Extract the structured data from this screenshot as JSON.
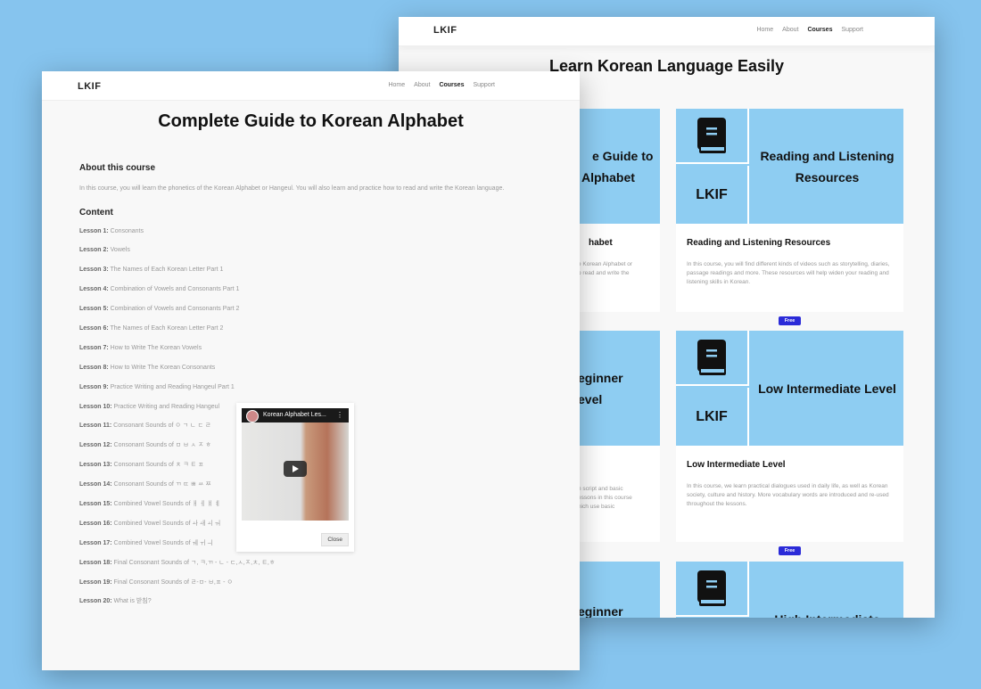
{
  "back_window": {
    "logo": "LKIF",
    "nav": [
      "Home",
      "About",
      "Courses",
      "Support"
    ],
    "title": "Learn Korean Language Easily",
    "left_cards": [
      {
        "tile_lines": [
          "e Guide to",
          "Alphabet"
        ],
        "title": "habet",
        "desc": [
          "e Korean Alphabet or",
          "o read and write the"
        ]
      },
      {
        "tile_lines": [
          "eginner",
          "evel"
        ],
        "title": "",
        "desc": [
          "n script and basic",
          "essons in this course",
          "hich use basic"
        ]
      },
      {
        "tile_lines": [
          "eginner"
        ],
        "title": "",
        "desc": []
      }
    ],
    "cards": [
      {
        "logo": "LKIF",
        "tile_title": "Reading and Listening Resources",
        "title": "Reading and Listening Resources",
        "desc": "In this course, you will find different kinds of videos such as storytelling, diaries, passage readings and more. These resources will help widen your reading and listening skills in Korean.",
        "badge": "Free"
      },
      {
        "logo": "LKIF",
        "tile_title": "Low Intermediate Level",
        "title": "Low Intermediate Level",
        "desc": "In this course, we learn practical dialogues used in daily life, as well as Korean society, culture and history. More vocabulary words are introduced and re-used throughout the lessons.",
        "badge": "Free"
      },
      {
        "logo": "",
        "tile_title": "High Intermediate",
        "title": "",
        "desc": "",
        "badge": ""
      }
    ]
  },
  "front_window": {
    "logo": "LKIF",
    "nav": [
      "Home",
      "About",
      "Courses",
      "Support"
    ],
    "title": "Complete Guide to Korean Alphabet",
    "about_heading": "About this course",
    "about_text": "In this course, you will learn the phonetics of the Korean Alphabet or Hangeul. You will also learn and practice how to read and write the Korean language.",
    "content_heading": "Content",
    "lessons": [
      {
        "label": "Lesson 1:",
        "title": "Consonants"
      },
      {
        "label": "Lesson 2:",
        "title": "Vowels"
      },
      {
        "label": "Lesson 3:",
        "title": "The Names of Each Korean Letter Part 1"
      },
      {
        "label": "Lesson 4:",
        "title": "Combination of Vowels and Consonants Part 1"
      },
      {
        "label": "Lesson 5:",
        "title": "Combination of Vowels and Consonants Part 2"
      },
      {
        "label": "Lesson 6:",
        "title": "The Names of Each Korean Letter Part 2"
      },
      {
        "label": "Lesson 7:",
        "title": "How to Write The Korean Vowels"
      },
      {
        "label": "Lesson 8:",
        "title": "How to Write The Korean Consonants"
      },
      {
        "label": "Lesson 9:",
        "title": "Practice Writing and Reading Hangeul Part 1"
      },
      {
        "label": "Lesson 10:",
        "title": "Practice Writing and Reading Hangeul"
      },
      {
        "label": "Lesson 11:",
        "title": "Consonant Sounds of ㅇ ㄱ ㄴ ㄷ ㄹ"
      },
      {
        "label": "Lesson 12:",
        "title": "Consonant Sounds of ㅁ ㅂ ㅅ ㅈ ㅎ"
      },
      {
        "label": "Lesson 13:",
        "title": "Consonant Sounds of ㅊ ㅋ ㅌ ㅍ"
      },
      {
        "label": "Lesson 14:",
        "title": "Consonant Sounds of ㄲ ㄸ ㅃ ㅆ ㅉ"
      },
      {
        "label": "Lesson 15:",
        "title": "Combined Vowel Sounds of ㅐ ㅔ ㅒ ㅖ"
      },
      {
        "label": "Lesson 16:",
        "title": "Combined Vowel Sounds of ㅘ ㅙ ㅚ ㅝ"
      },
      {
        "label": "Lesson 17:",
        "title": "Combined Vowel Sounds of ㅞ ㅟ ㅢ"
      },
      {
        "label": "Lesson 18:",
        "title": "Final Consonant Sounds of ㄱ, ㅋ,ㄲ - ㄴ - ㄷ,ㅅ,ㅈ,ㅊ, ㅌ,ㅎ"
      },
      {
        "label": "Lesson 19:",
        "title": "Final Consonant Sounds of ㄹ-ㅁ- ㅂ,ㅍ - ㅇ"
      },
      {
        "label": "Lesson 20:",
        "title": "What is 받침?"
      }
    ],
    "video": {
      "title": "Korean Alphabet Les...",
      "close_label": "Close"
    }
  },
  "colors": {
    "background": "#86c4ee",
    "tile": "#8ecdf2",
    "badge": "#2b2bd8"
  }
}
